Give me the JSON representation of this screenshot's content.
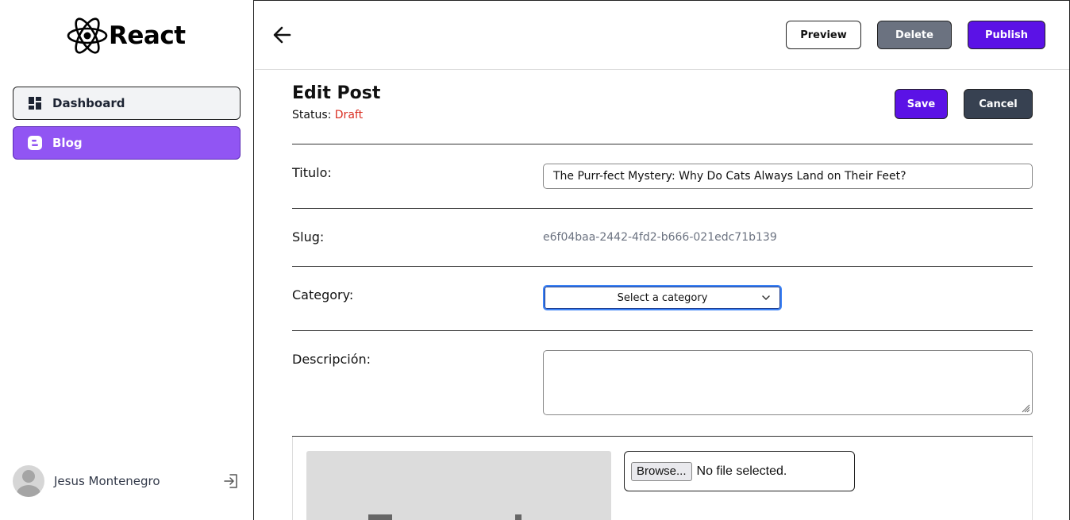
{
  "app": {
    "logo_text": "React"
  },
  "sidebar": {
    "items": [
      {
        "label": "Dashboard",
        "icon": "dashboard-icon"
      },
      {
        "label": "Blog",
        "icon": "blogger-icon",
        "active": true
      }
    ],
    "user": {
      "name": "Jesus Montenegro"
    }
  },
  "header": {
    "preview_label": "Preview",
    "delete_label": "Delete",
    "publish_label": "Publish"
  },
  "editor": {
    "title": "Edit Post",
    "status_label": "Status:",
    "status_value": "Draft",
    "save_label": "Save",
    "cancel_label": "Cancel",
    "fields": {
      "titulo_label": "Titulo:",
      "titulo_value": "The Purr-fect Mystery: Why Do Cats Always Land on Their Feet?",
      "slug_label": "Slug:",
      "slug_value": "e6f04baa-2442-4fd2-b666-021edc71b139",
      "category_label": "Category:",
      "category_selected": "Select a category",
      "descripcion_label": "Descripción:",
      "descripcion_value": ""
    },
    "file": {
      "browse_label": "Browse...",
      "status": "No file selected."
    }
  },
  "colors": {
    "accent": "#5b12e6",
    "sidebar_active": "#9155f3",
    "status_draft": "#d92d20",
    "delete_btn": "#6b7280",
    "cancel_btn": "#374151"
  }
}
